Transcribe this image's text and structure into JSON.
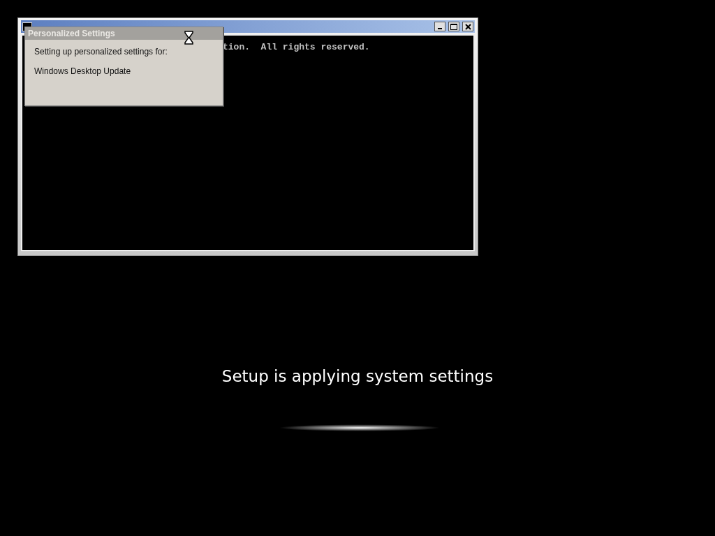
{
  "console_window": {
    "lines": [
      "tion.  All rights reserved."
    ],
    "controls": [
      {
        "kind": "minimize"
      },
      {
        "kind": "maximize"
      },
      {
        "kind": "close"
      }
    ]
  },
  "dialog": {
    "title": "Personalized Settings",
    "lines": [
      "Setting up personalized settings for:",
      "Windows Desktop Update"
    ]
  },
  "setup": {
    "message": "Setup is applying system settings"
  }
}
